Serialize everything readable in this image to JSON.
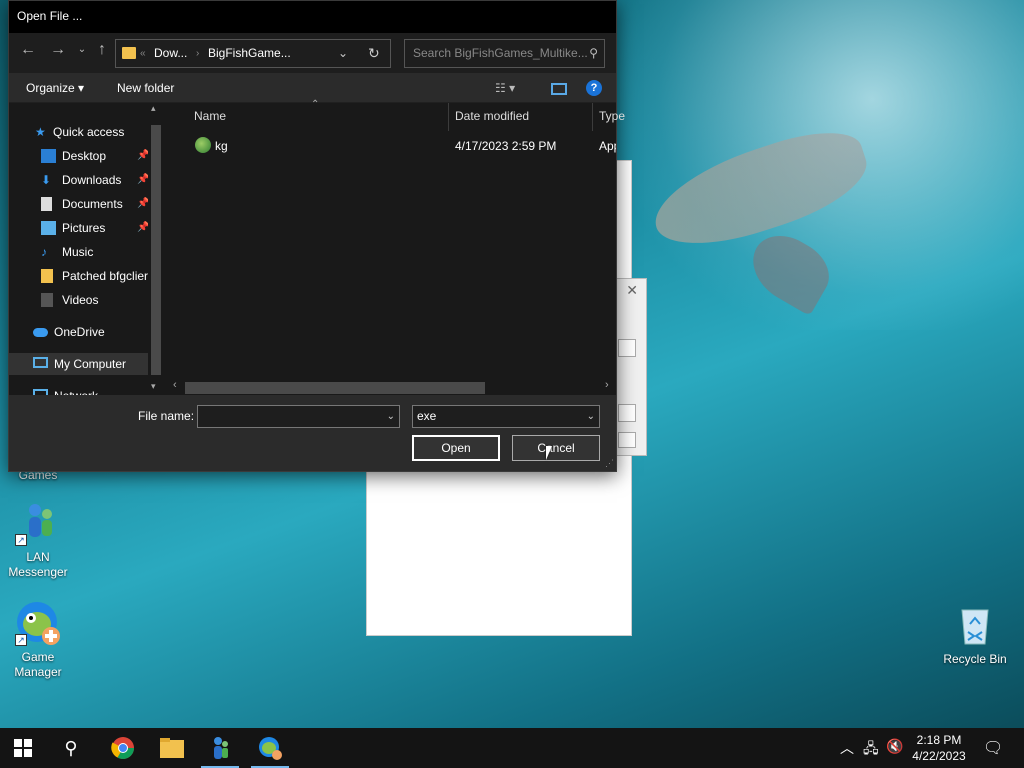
{
  "dialog": {
    "title": "Open File ...",
    "address": {
      "crumb1": "Dow...",
      "crumb2": "BigFishGame..."
    },
    "search_placeholder": "Search BigFishGames_Multike...",
    "toolbar": {
      "organize": "Organize",
      "new_folder": "New folder"
    },
    "nav": {
      "quick_access": "Quick access",
      "desktop": "Desktop",
      "downloads": "Downloads",
      "documents": "Documents",
      "pictures": "Pictures",
      "music": "Music",
      "patched": "Patched bfgclier",
      "videos": "Videos",
      "onedrive": "OneDrive",
      "my_computer": "My Computer",
      "network": "Network"
    },
    "columns": {
      "name": "Name",
      "date": "Date modified",
      "type": "Type"
    },
    "files": [
      {
        "name": "kg",
        "date": "4/17/2023 2:59 PM",
        "type": "Appli"
      }
    ],
    "file_name_label": "File name:",
    "file_name_value": "",
    "file_type": "exe",
    "open_button": "Open",
    "cancel_button": "Cancel"
  },
  "desktop": {
    "icons": {
      "games": "Games",
      "lan_messenger": [
        "LAN",
        "Messenger"
      ],
      "game_manager": [
        "Game",
        "Manager"
      ],
      "recycle_bin": "Recycle Bin"
    }
  },
  "taskbar": {
    "time": "2:18 PM",
    "date": "4/22/2023"
  },
  "colors": {
    "accent": "#1a73d8",
    "dialog_bg": "#2b2b2b",
    "folder": "#f2c14e"
  }
}
